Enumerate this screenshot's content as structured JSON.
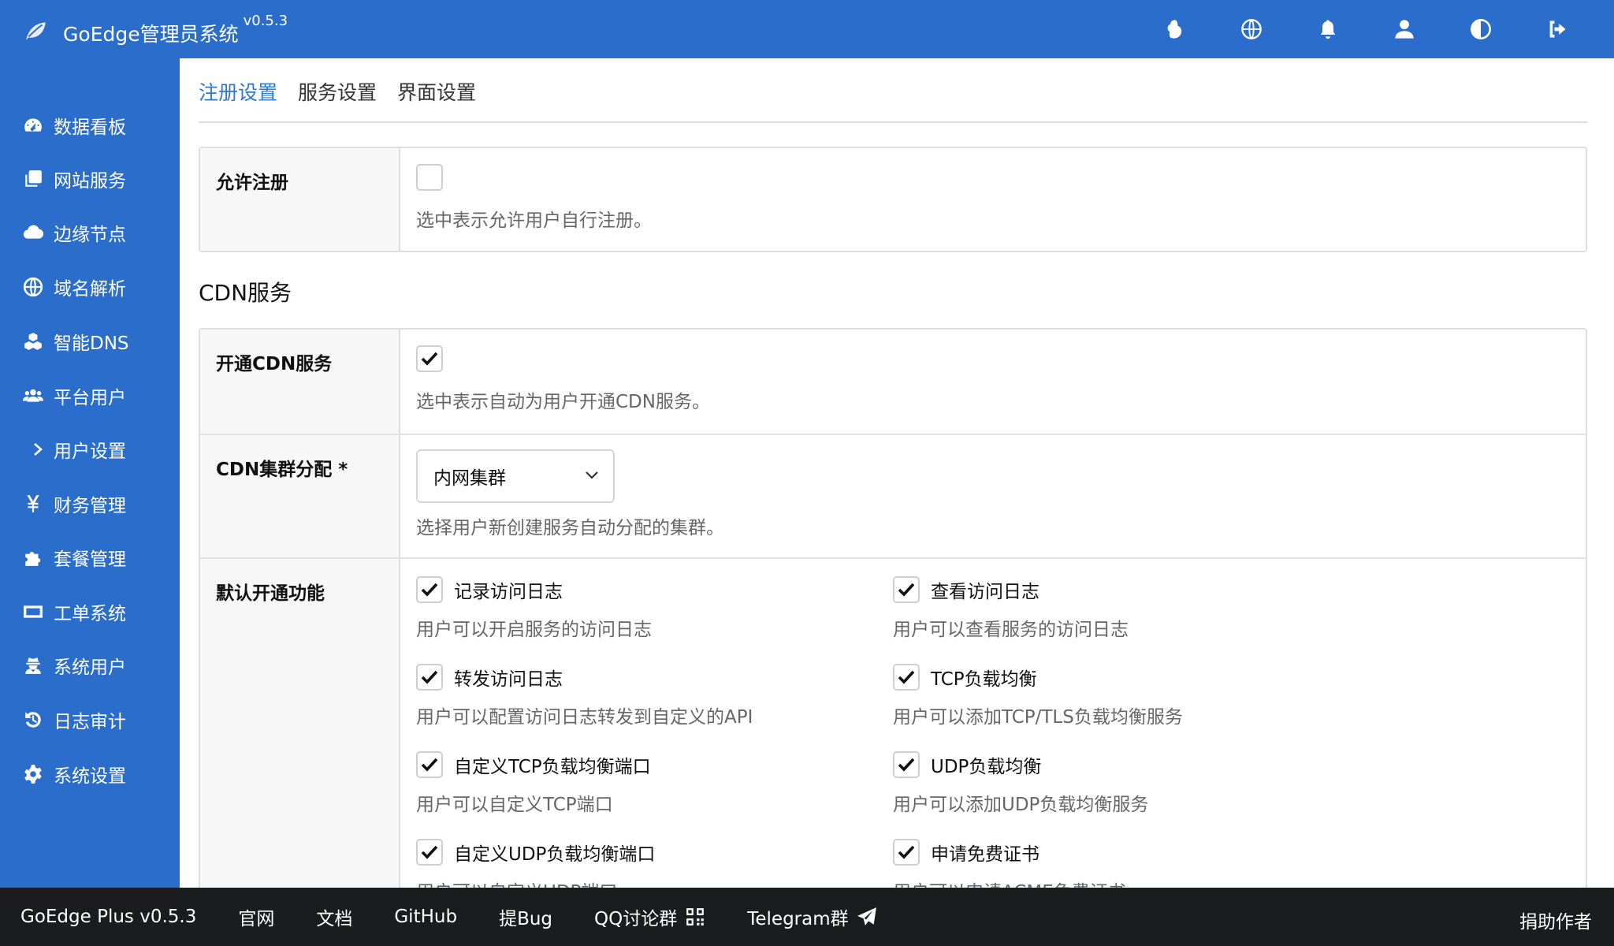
{
  "app": {
    "title": "GoEdge管理员系统",
    "version": "v0.5.3"
  },
  "topbar_icons": [
    "leaf-logo-icon",
    "cloud-icon",
    "globe-icon",
    "bell-icon",
    "user-icon",
    "contrast-icon",
    "logout-icon"
  ],
  "sidebar": {
    "items": [
      {
        "label": "数据看板",
        "icon": "dashboard-icon"
      },
      {
        "label": "网站服务",
        "icon": "clone-icon"
      },
      {
        "label": "边缘节点",
        "icon": "cloud-icon"
      },
      {
        "label": "域名解析",
        "icon": "globe-icon"
      },
      {
        "label": "智能DNS",
        "icon": "cubes-icon"
      },
      {
        "label": "平台用户",
        "icon": "users-icon"
      },
      {
        "label": "用户设置",
        "icon": "chevron-right-icon"
      },
      {
        "label": "财务管理",
        "icon": "yen-icon"
      },
      {
        "label": "套餐管理",
        "icon": "puzzle-icon"
      },
      {
        "label": "工单系统",
        "icon": "ticket-icon"
      },
      {
        "label": "系统用户",
        "icon": "user-secret-icon"
      },
      {
        "label": "日志审计",
        "icon": "history-icon"
      },
      {
        "label": "系统设置",
        "icon": "gear-icon"
      }
    ]
  },
  "tabs": [
    {
      "label": "注册设置",
      "active": true
    },
    {
      "label": "服务设置",
      "active": false
    },
    {
      "label": "界面设置",
      "active": false
    }
  ],
  "register": {
    "label": "允许注册",
    "checked": false,
    "desc": "选中表示允许用户自行注册。"
  },
  "cdn_section_title": "CDN服务",
  "cdn": {
    "enable": {
      "label": "开通CDN服务",
      "checked": true,
      "desc": "选中表示自动为用户开通CDN服务。"
    },
    "cluster": {
      "label": "CDN集群分配 *",
      "selected": "内网集群",
      "desc": "选择用户新创建服务自动分配的集群。"
    },
    "features": {
      "label": "默认开通功能",
      "items": [
        {
          "name": "记录访问日志",
          "desc": "用户可以开启服务的访问日志",
          "checked": true
        },
        {
          "name": "查看访问日志",
          "desc": "用户可以查看服务的访问日志",
          "checked": true
        },
        {
          "name": "转发访问日志",
          "desc": "用户可以配置访问日志转发到自定义的API",
          "checked": true
        },
        {
          "name": "TCP负载均衡",
          "desc": "用户可以添加TCP/TLS负载均衡服务",
          "checked": true
        },
        {
          "name": "自定义TCP负载均衡端口",
          "desc": "用户可以自定义TCP端口",
          "checked": true
        },
        {
          "name": "UDP负载均衡",
          "desc": "用户可以添加UDP负载均衡服务",
          "checked": true
        },
        {
          "name": "自定义UDP负载均衡端口",
          "desc": "用户可以自定义UDP端口",
          "checked": true
        },
        {
          "name": "申请免费证书",
          "desc": "用户可以申请ACME免费证书",
          "checked": true
        }
      ]
    }
  },
  "footer": {
    "links": [
      "GoEdge Plus v0.5.3",
      "官网",
      "文档",
      "GitHub",
      "提Bug",
      "QQ讨论群",
      "Telegram群"
    ],
    "right": "捐助作者"
  }
}
